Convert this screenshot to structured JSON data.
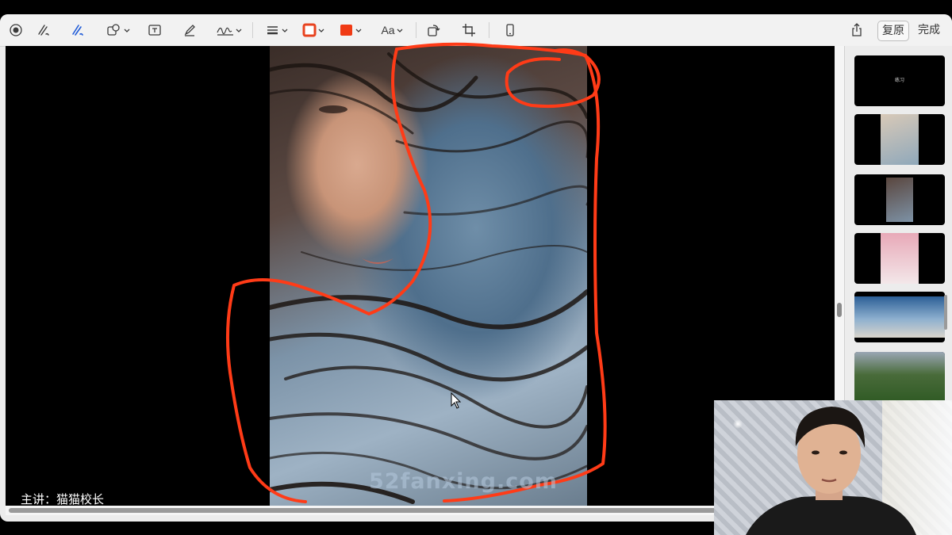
{
  "toolbar": {
    "tools": [
      {
        "name": "record"
      },
      {
        "name": "sketch"
      },
      {
        "name": "draw"
      },
      {
        "name": "shapes"
      },
      {
        "name": "text-box"
      },
      {
        "name": "highlight"
      },
      {
        "name": "sign"
      },
      {
        "name": "line-style"
      },
      {
        "name": "border-color"
      },
      {
        "name": "fill-color"
      },
      {
        "name": "text-style"
      },
      {
        "name": "rotate"
      },
      {
        "name": "crop"
      },
      {
        "name": "device"
      }
    ],
    "text_style_label": "Aa",
    "revert_label": "复原",
    "done_label": "完成",
    "border_color": "#e8431f",
    "fill_color": "#f03a14"
  },
  "sidebar": {
    "thumbnails": [
      {
        "label": "练习",
        "selected": true
      },
      {
        "label": ""
      },
      {
        "label": ""
      },
      {
        "label": ""
      },
      {
        "label": ""
      },
      {
        "label": ""
      }
    ]
  },
  "overlay": {
    "caption": "主讲：猫猫校长",
    "watermark": "52fanxing.com"
  },
  "colors": {
    "annotation_stroke": "#ff3b17",
    "canvas_bg": "#000000"
  }
}
